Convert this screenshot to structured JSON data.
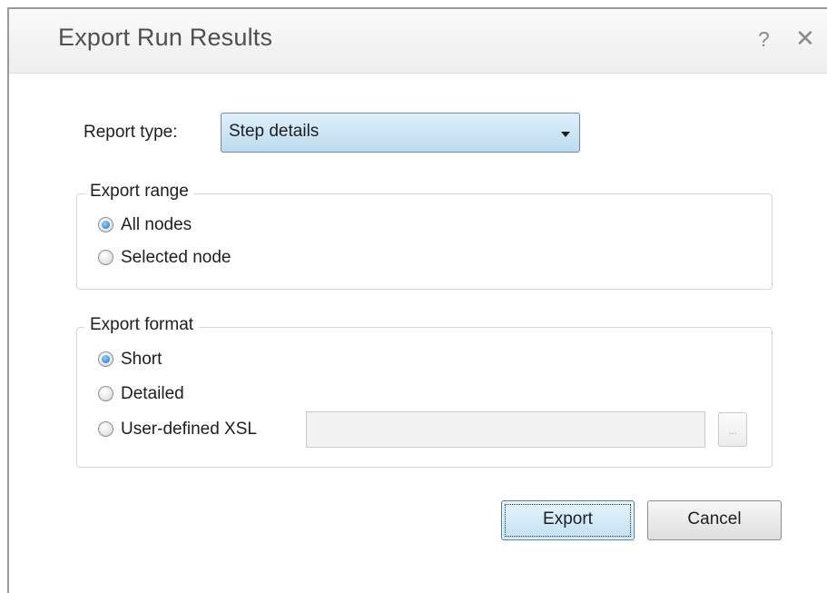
{
  "dialog": {
    "title": "Export Run Results",
    "help_glyph": "?",
    "close_glyph": "✕"
  },
  "report_type": {
    "label": "Report type:",
    "selected": "Step details"
  },
  "export_range": {
    "legend": "Export range",
    "options": [
      {
        "label": "All nodes",
        "checked": true
      },
      {
        "label": "Selected node",
        "checked": false
      }
    ]
  },
  "export_format": {
    "legend": "Export format",
    "options": [
      {
        "label": "Short",
        "checked": true
      },
      {
        "label": "Detailed",
        "checked": false
      },
      {
        "label": "User-defined XSL",
        "checked": false
      }
    ],
    "xsl_path_value": "",
    "browse_label": "..."
  },
  "buttons": {
    "export": "Export",
    "cancel": "Cancel"
  }
}
